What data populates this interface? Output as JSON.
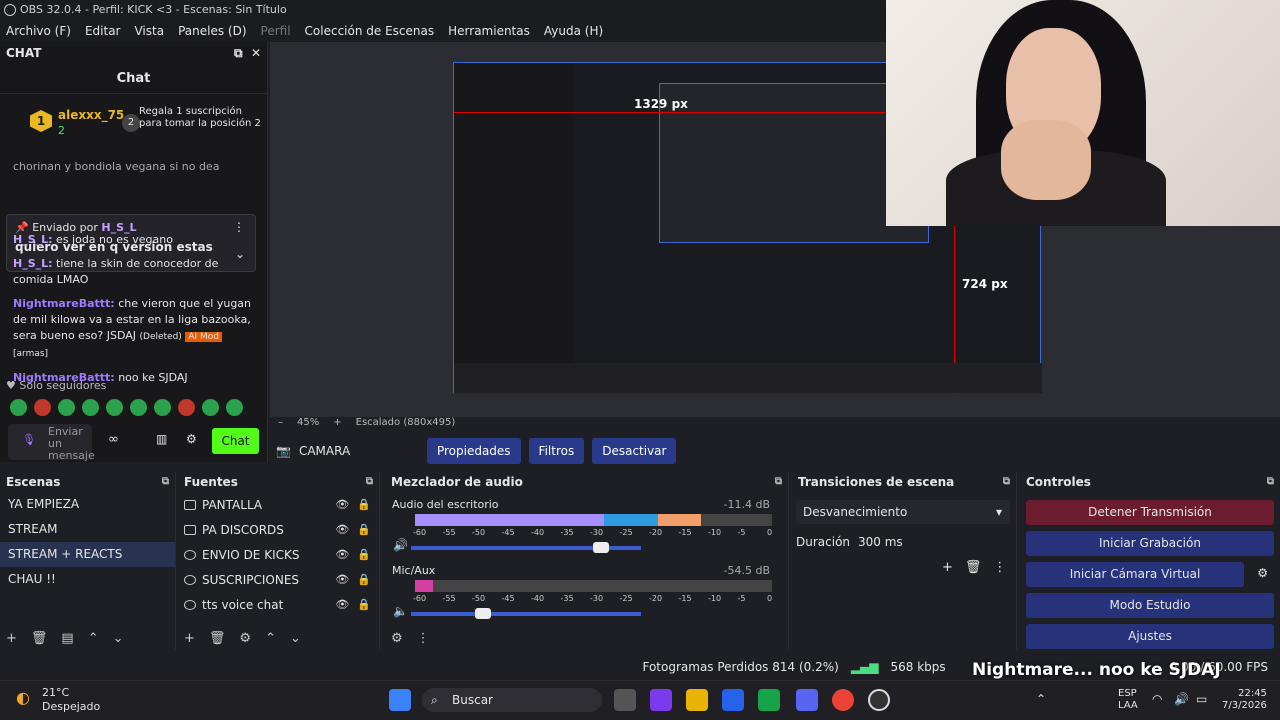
{
  "titlebar": {
    "text": "OBS 32.0.4 - Perfil: KICK <3 - Escenas: Sin Título"
  },
  "menu": [
    "Archivo (F)",
    "Editar",
    "Vista",
    "Paneles (D)",
    "Perfil",
    "Colección de Escenas",
    "Herramientas",
    "Ayuda (H)"
  ],
  "chat": {
    "dock_title": "CHAT",
    "title": "Chat",
    "gifter": {
      "rank": "1",
      "name": "alexxx_75",
      "count": "2",
      "gift_text": "Regala 1 suscripción para tomar la posición 2",
      "position": "2"
    },
    "scroll_text": "chorinan y bondiola vegana si no dea",
    "pinned": {
      "label": "Enviado por",
      "user": "H_S_L",
      "text": "quiero ver en q version estas"
    },
    "messages": [
      {
        "user": "H_S_L:",
        "text": "es joda no es vegano"
      },
      {
        "user": "H_S_L:",
        "text": "tiene la skin de conocedor de comida LMAO"
      },
      {
        "user": "NightmareBattt:",
        "text": "che vieron que el yugan de mil kilowa va a estar en la liga bazooka, sera bueno eso? JSDAJ",
        "deleted": "(Deleted)",
        "aimod": "AI Mod",
        "tag": "[armas]"
      },
      {
        "user": "NightmareBattt:",
        "text": "noo ke SJDAJ"
      }
    ],
    "followers": "Solo seguidores",
    "input_placeholder": "Enviar un mensaje",
    "send": "Chat"
  },
  "preview": {
    "measure_w": "1329 px",
    "measure_h": "724 px",
    "zoom": "45%",
    "scale": "Escalado (880x495)"
  },
  "source_bar": {
    "source": "CAMARA",
    "props": "Propiedades",
    "filters": "Filtros",
    "deactivate": "Desactivar"
  },
  "scenes": {
    "title": "Escenas",
    "items": [
      "YA EMPIEZA",
      "STREAM",
      "STREAM + REACTS",
      "CHAU !!"
    ],
    "selected": 2
  },
  "sources": {
    "title": "Fuentes",
    "items": [
      "PANTALLA",
      "PA DISCORDS",
      "ENVIO DE KICKS",
      "SUSCRIPCIONES",
      "tts voice chat"
    ]
  },
  "mixer": {
    "title": "Mezclador de audio",
    "channels": [
      {
        "name": "Audio del escritorio",
        "db": "-11.4 dB",
        "level": 0.8,
        "volume": 0.85
      },
      {
        "name": "Mic/Aux",
        "db": "-54.5 dB",
        "level": 0.05,
        "volume": 0.3
      }
    ],
    "ticks": [
      "-60",
      "-55",
      "-50",
      "-45",
      "-40",
      "-35",
      "-30",
      "-25",
      "-20",
      "-15",
      "-10",
      "-5",
      "0"
    ]
  },
  "transitions": {
    "title": "Transiciones de escena",
    "type": "Desvanecimiento",
    "duration_label": "Duración",
    "duration": "300 ms"
  },
  "controls": {
    "title": "Controles",
    "buttons": [
      "Detener Transmisión",
      "Iniciar Grabación",
      "Iniciar Cámara Virtual",
      "Modo Estudio",
      "Ajustes"
    ]
  },
  "status": {
    "frames": "Fotogramas Perdidos 814 (0.2%)",
    "kbps": "568 kbps",
    "fps": "0.00 / 60.00 FPS"
  },
  "overlay": {
    "text": "Nightmare... noo ke SJDAJ"
  },
  "taskbar": {
    "weather_temp": "21°C",
    "weather_desc": "Despejado",
    "search": "Buscar",
    "lang1": "ESP",
    "lang2": "LAA",
    "time": "22:45",
    "date": "7/3/2026"
  }
}
